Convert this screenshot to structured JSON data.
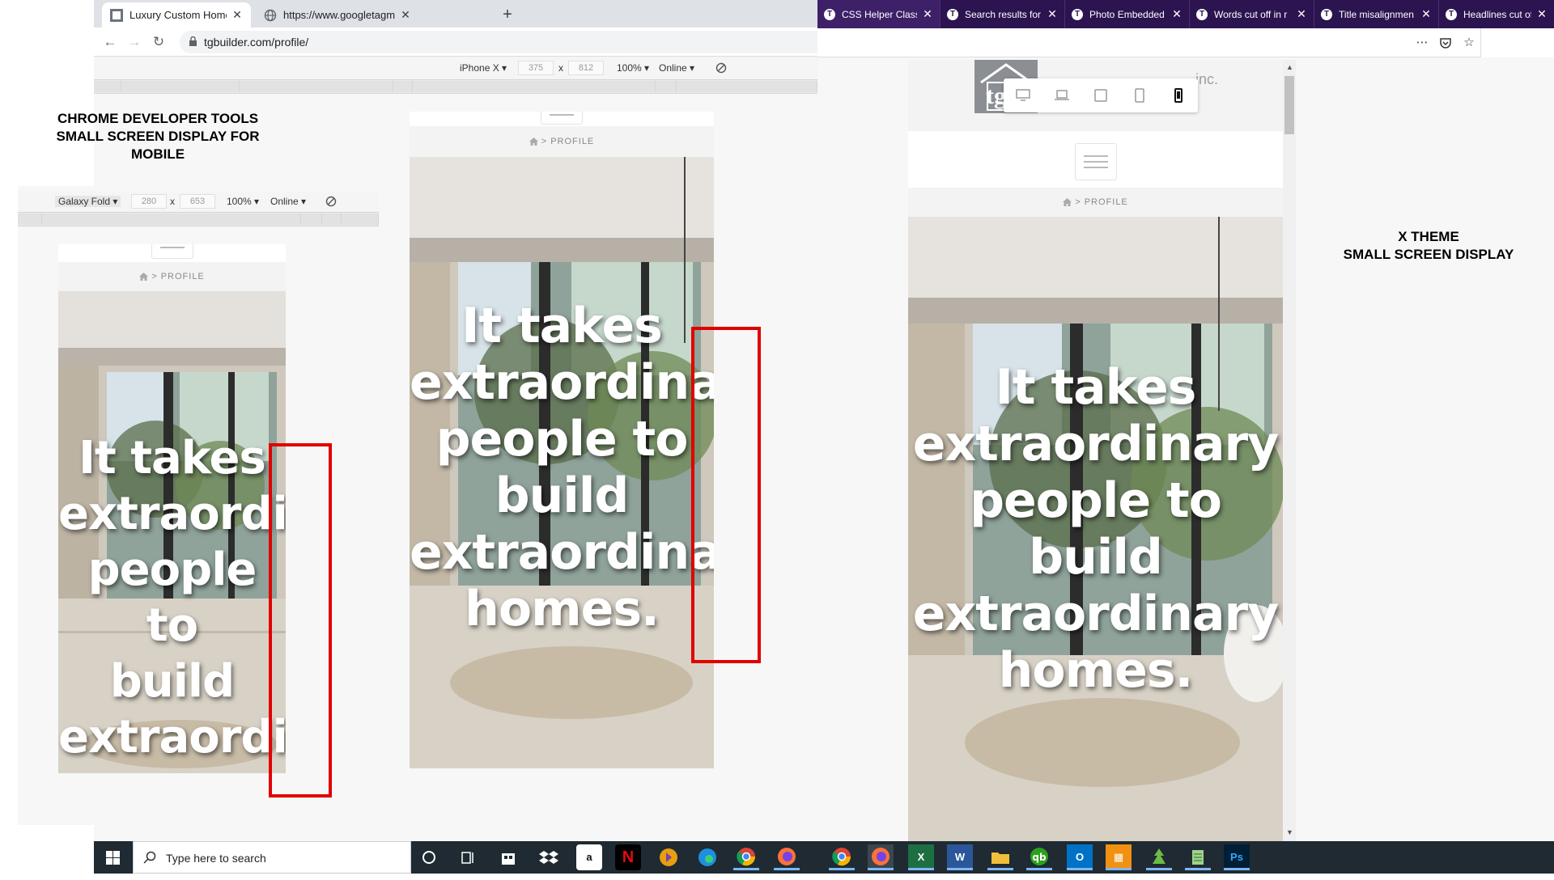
{
  "left_browser": {
    "tabs": [
      {
        "title": "Luxury Custom Home Constructi",
        "active": true
      },
      {
        "title": "https://www.googletagmanager.",
        "active": false
      }
    ],
    "url": "tgbuilder.com/profile/"
  },
  "device_toolbar": {
    "device": "iPhone X",
    "width": "375",
    "height": "812",
    "zoom": "100%",
    "network": "Online",
    "times": "x"
  },
  "galaxy_toolbar": {
    "device": "Galaxy Fold",
    "width": "280",
    "height": "653",
    "zoom": "100%",
    "network": "Online",
    "times": "x"
  },
  "annotations": {
    "chrome_title": [
      "CHROME DEVELOPER TOOLS",
      "SMALL SCREEN DISPLAY FOR",
      "MOBILE"
    ],
    "xtheme_title": [
      "X THEME",
      "SMALL SCREEN DISPLAY"
    ]
  },
  "site": {
    "breadcrumb": "PROFILE",
    "breadcrumb_sep": ">",
    "headline_lines_full": [
      "It takes",
      "extraordinary",
      "people to",
      "build",
      "extraordinary",
      "homes."
    ],
    "headline_lines_iphone": [
      "It takes",
      "extraordinar",
      "people to",
      "build",
      "extraordinar",
      "homes."
    ],
    "headline_lines_fold": [
      "It takes",
      "extraordi",
      "people",
      "to",
      "build",
      "extraordi"
    ],
    "logo_text": "inc.",
    "logo_initial": "tg"
  },
  "right_browser": {
    "tabs": [
      {
        "title": "CSS Helper Classe"
      },
      {
        "title": "Search results for"
      },
      {
        "title": "Photo Embedded"
      },
      {
        "title": "Words cut off in r"
      },
      {
        "title": "Title misalignmen"
      },
      {
        "title": "Headlines cut off"
      }
    ]
  },
  "taskbar": {
    "search_placeholder": "Type here to search",
    "apps": [
      "cortana",
      "task-view",
      "store",
      "dropbox",
      "amazon",
      "netflix",
      "plex",
      "edge",
      "chrome",
      "firefox",
      "chrome",
      "firefox",
      "excel",
      "word",
      "file-explorer",
      "quickbooks",
      "outlook",
      "app-orange",
      "app-green",
      "notepad",
      "photoshop"
    ]
  },
  "colors": {
    "highlight_red": "#e00000",
    "firefox_tabs": "#2b1450",
    "taskbar": "#1f2a32"
  }
}
